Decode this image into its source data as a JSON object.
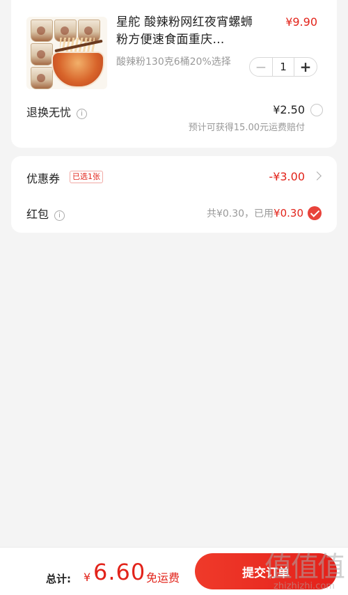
{
  "product": {
    "title": "星舵 酸辣粉网红夜宵螺蛳粉方便速食面重庆…",
    "price": "¥9.90",
    "spec": "酸辣粉130克6桶20%选择",
    "quantity": "1",
    "minus_symbol": "−",
    "plus_symbol": "+"
  },
  "returns": {
    "label": "退换无忧",
    "info_symbol": "i",
    "price": "¥2.50",
    "note": "预计可获得15.00元运费赔付"
  },
  "coupon": {
    "label": "优惠券",
    "tag": "已选1张",
    "value": "-¥3.00"
  },
  "red_packet": {
    "label": "红包",
    "info_symbol": "i",
    "summary": "共¥0.30，已用",
    "used": "¥0.30"
  },
  "footer": {
    "total_label": "总计:",
    "currency": "¥",
    "total_amount": "6.60",
    "free_shipping": "免运费",
    "submit_label": "提交订单"
  },
  "watermark": {
    "logo": "值值值",
    "url": "zhizhizhi.com"
  },
  "colors": {
    "accent": "#e2231a",
    "background": "#f4f4f4"
  },
  "icons": [
    "info-icon",
    "chevron-right-icon",
    "check-circle-icon",
    "radio-empty-icon"
  ]
}
